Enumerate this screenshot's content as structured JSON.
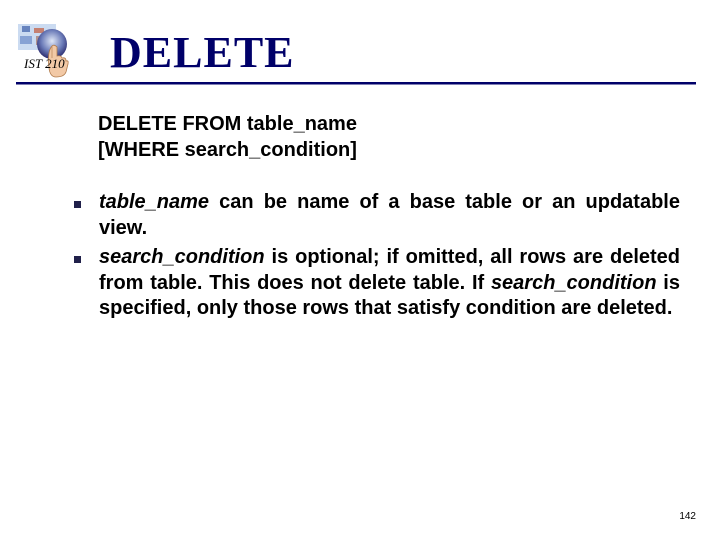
{
  "course_label": "IST 210",
  "title": "DELETE",
  "syntax": {
    "line1": "DELETE FROM table_name",
    "line2": "[WHERE search_condition]"
  },
  "bullets": [
    {
      "em1": "table_name",
      "rest": " can be name of a base table or an updatable view."
    },
    {
      "em1": "search_condition",
      "rest1": " is optional; if omitted, all rows are deleted from table. This does not delete table. If ",
      "em2": "search_condition",
      "rest2": " is specified, only those rows that satisfy condition are deleted."
    }
  ],
  "page_number": "142"
}
